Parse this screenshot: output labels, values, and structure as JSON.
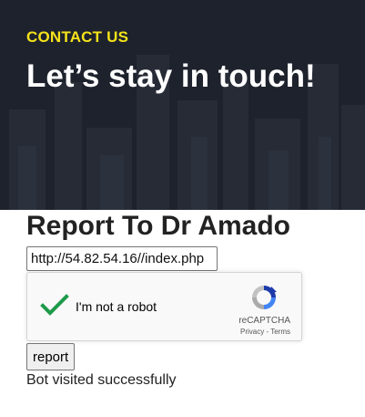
{
  "hero": {
    "eyebrow": "CONTACT US",
    "headline": "Let’s stay in touch!"
  },
  "form": {
    "title": "Report To Dr Amado",
    "url_value": "http://54.82.54.16//index.php",
    "captcha": {
      "label": "I'm not a robot",
      "checked": true,
      "brand": "reCAPTCHA",
      "privacy": "Privacy",
      "separator": "-",
      "terms": "Terms",
      "icon": "recaptcha-logo-icon",
      "check_color": "#1e9a4a"
    },
    "submit_label": "report",
    "status": "Bot visited successfully"
  },
  "colors": {
    "eyebrow": "#f5e21b",
    "hero_background": "#1d222c"
  }
}
